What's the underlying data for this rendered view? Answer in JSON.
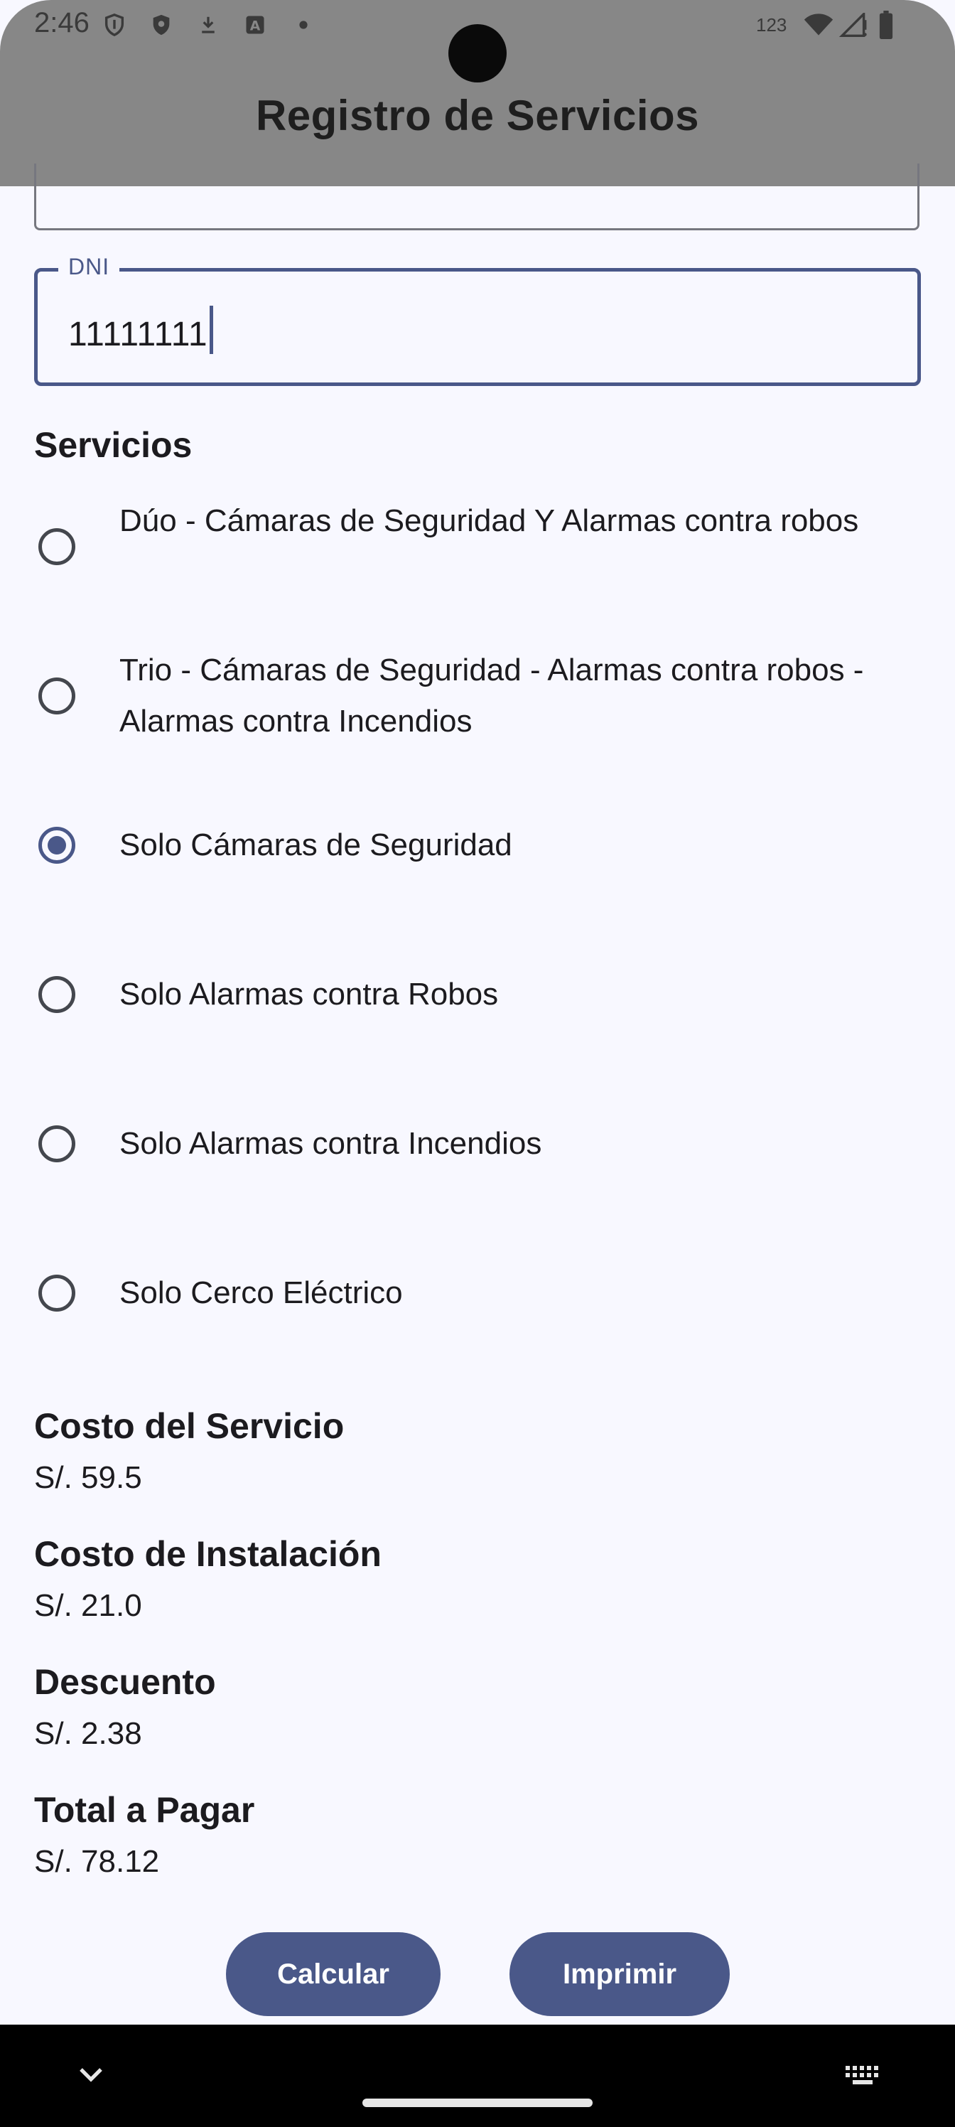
{
  "status_bar": {
    "time": "2:46",
    "network_label": "123",
    "icons": [
      "shield-icon",
      "shield-filled-icon",
      "download-icon",
      "keyboard-a-icon",
      "dot-icon",
      "wifi-icon",
      "signal-icon",
      "battery-icon"
    ]
  },
  "app_bar": {
    "title": "Registro de Servicios"
  },
  "form": {
    "dni_label": "DNI",
    "dni_value": "11111111"
  },
  "services": {
    "title": "Servicios",
    "options": [
      {
        "label": "Dúo - Cámaras de Seguridad Y Alarmas contra robos",
        "selected": false
      },
      {
        "label": "Trio - Cámaras de Seguridad - Alarmas contra robos - Alarmas contra Incendios",
        "selected": false
      },
      {
        "label": "Solo Cámaras de Seguridad",
        "selected": true
      },
      {
        "label": "Solo Alarmas contra Robos",
        "selected": false
      },
      {
        "label": "Solo Alarmas contra Incendios",
        "selected": false
      },
      {
        "label": "Solo Cerco Eléctrico",
        "selected": false
      }
    ]
  },
  "costs": {
    "service_title": "Costo del Servicio",
    "service_value": "S/. 59.5",
    "installation_title": "Costo de Instalación",
    "installation_value": "S/. 21.0",
    "discount_title": "Descuento",
    "discount_value": "S/. 2.38",
    "total_title": "Total a Pagar",
    "total_value": "S/. 78.12"
  },
  "buttons": {
    "calculate": "Calcular",
    "print": "Imprimir"
  },
  "colors": {
    "accent": "#4a5889",
    "app_bar": "#878787",
    "background": "#f8f8ff"
  }
}
